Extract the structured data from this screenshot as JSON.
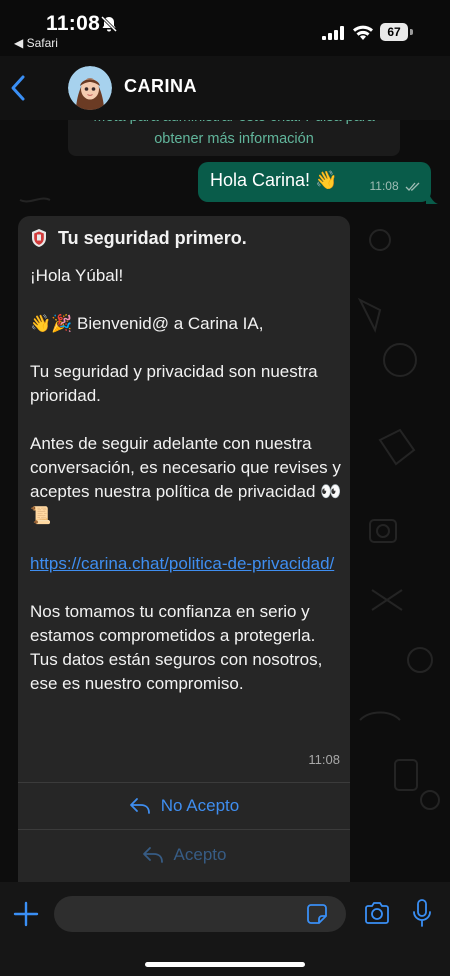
{
  "status_bar": {
    "time": "11:08",
    "back_app": "◀ Safari",
    "battery": "67"
  },
  "header": {
    "contact_name": "CARINA",
    "icons": [
      "chevron-left-icon",
      "avatar"
    ]
  },
  "chat": {
    "system_notice": {
      "line1": "Meta para administrar este chat. Pulsa para",
      "line2": "obtener más información"
    },
    "outgoing": {
      "text": "Hola Carina! 👋",
      "time": "11:08"
    },
    "incoming": {
      "title": "Tu seguridad primero.",
      "greeting": "¡Hola Yúbal!",
      "welcome": "👋🎉 Bienvenid@ a Carina IA,",
      "security": "Tu seguridad y privacidad son nuestra prioridad.",
      "before": "Antes de seguir adelante con nuestra conversación, es necesario que revises y aceptes nuestra política de privacidad 👀📜",
      "link": "https://carina.chat/politica-de-privacidad/",
      "trust": "Nos tomamos tu confianza en serio y estamos comprometidos a protegerla. Tus datos están seguros con nosotros, ese es nuestro compromiso.",
      "time": "11:08",
      "button_reject": "No Acepto",
      "button_accept": "Acepto"
    }
  },
  "input_bar": {
    "placeholder": ""
  },
  "colors": {
    "outgoing_bubble": "#095c4a",
    "incoming_bubble": "#262626",
    "link": "#3f8ef0",
    "accent_blue": "#3a8ff5"
  }
}
